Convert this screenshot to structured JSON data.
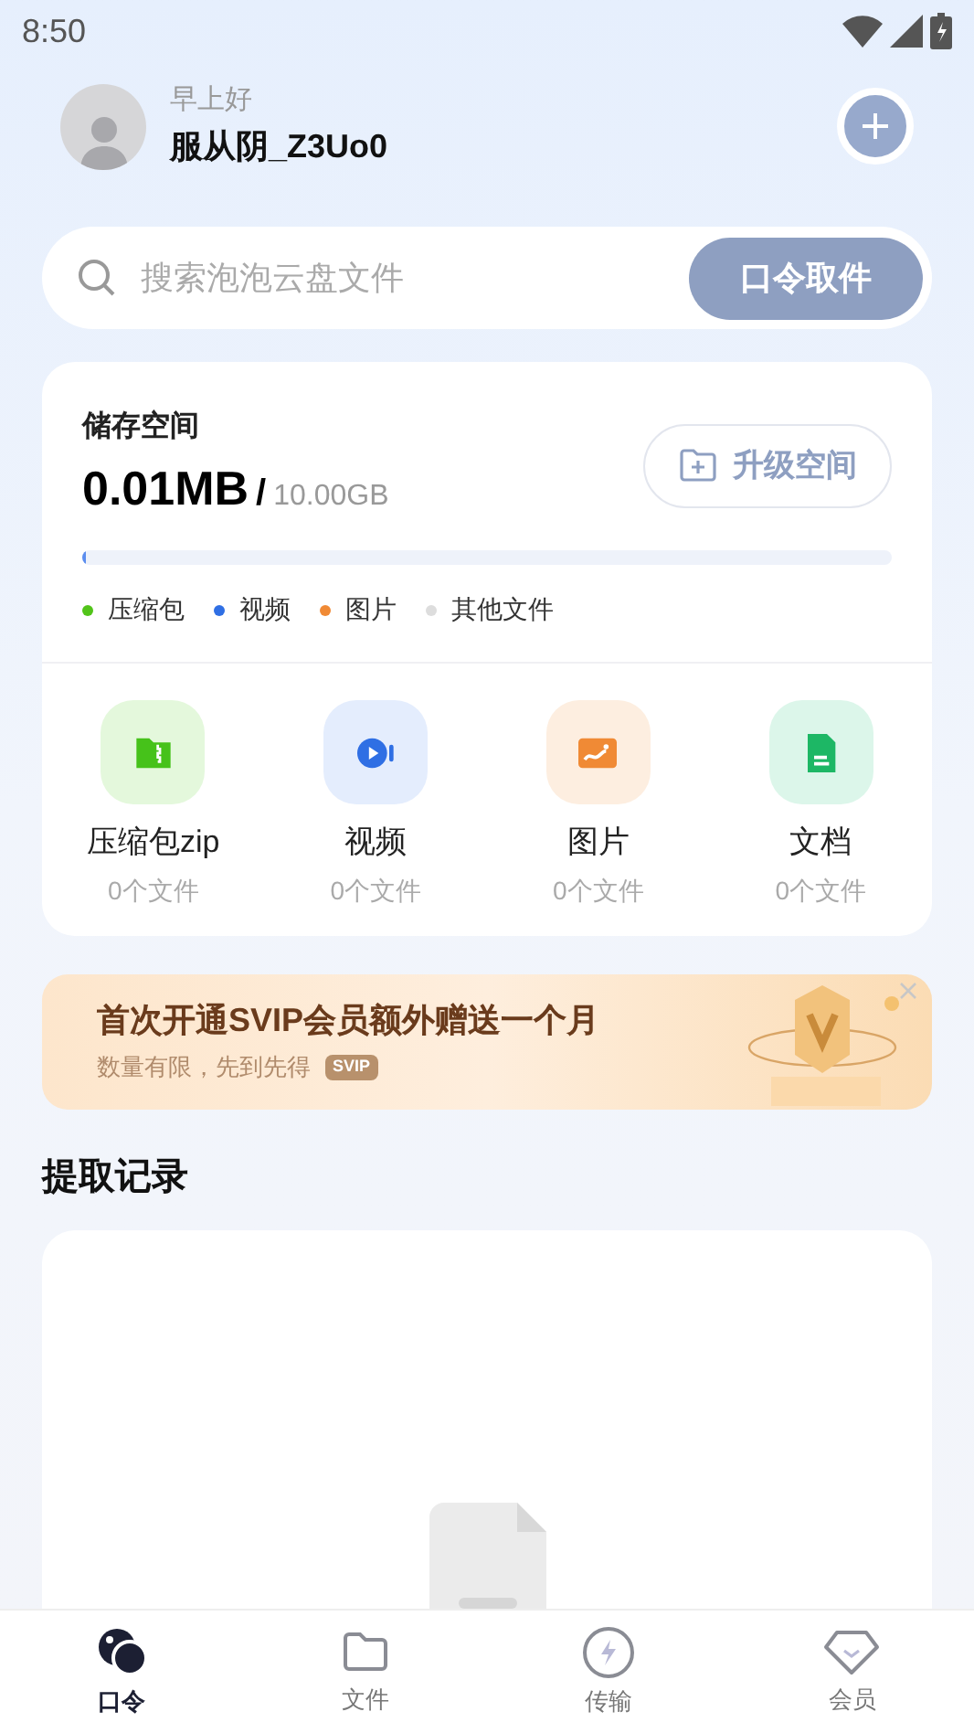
{
  "status_bar": {
    "time": "8:50"
  },
  "header": {
    "greeting": "早上好",
    "username": "服从阴_Z3Uo0"
  },
  "search": {
    "placeholder": "搜索泡泡云盘文件",
    "button": "口令取件"
  },
  "storage": {
    "title": "储存空间",
    "used": "0.01MB",
    "separator": "/",
    "total": "10.00GB",
    "upgrade_button": "升级空间",
    "level": 0.005,
    "legend": [
      {
        "label": "压缩包",
        "color": "#52c41a"
      },
      {
        "label": "视频",
        "color": "#2f6fe4"
      },
      {
        "label": "图片",
        "color": "#f08a35"
      },
      {
        "label": "其他文件",
        "color": "#dddddd"
      }
    ],
    "categories": [
      {
        "kind": "zip",
        "label": "压缩包zip",
        "count": "0个文件"
      },
      {
        "kind": "video",
        "label": "视频",
        "count": "0个文件"
      },
      {
        "kind": "image",
        "label": "图片",
        "count": "0个文件"
      },
      {
        "kind": "doc",
        "label": "文档",
        "count": "0个文件"
      }
    ]
  },
  "banner": {
    "title": "首次开通SVIP会员额外赠送一个月",
    "subtitle": "数量有限，先到先得",
    "badge": "SVIP"
  },
  "records": {
    "title": "提取记录"
  },
  "tab_bar": [
    {
      "kind": "token",
      "label": "口令",
      "selected": true
    },
    {
      "kind": "files",
      "label": "文件",
      "selected": false
    },
    {
      "kind": "transfer",
      "label": "传输",
      "selected": false
    },
    {
      "kind": "vip",
      "label": "会员",
      "selected": false
    }
  ]
}
